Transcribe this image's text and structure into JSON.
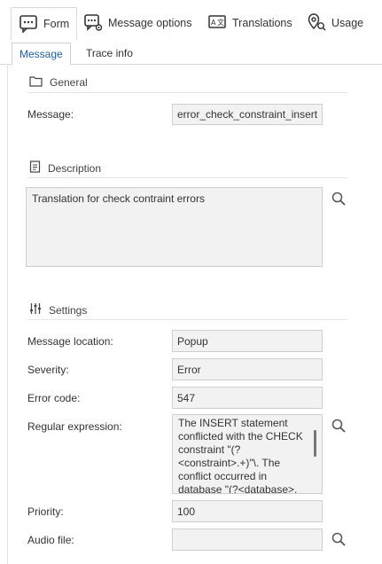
{
  "top_tabs": [
    {
      "label": "Form",
      "icon": "form-icon"
    },
    {
      "label": "Message options",
      "icon": "chat-settings-icon"
    },
    {
      "label": "Translations",
      "icon": "translate-icon"
    },
    {
      "label": "Usage",
      "icon": "usage-pin-icon"
    }
  ],
  "sub_tabs": [
    {
      "label": "Message"
    },
    {
      "label": "Trace info"
    }
  ],
  "general": {
    "heading": "General",
    "message_label": "Message:",
    "message_value": "error_check_constraint_insert"
  },
  "description": {
    "heading": "Description",
    "text": "Translation for check contraint errors"
  },
  "settings": {
    "heading": "Settings",
    "location_label": "Message location:",
    "location_value": "Popup",
    "severity_label": "Severity:",
    "severity_value": "Error",
    "error_code_label": "Error code:",
    "error_code_value": "547",
    "regex_label": "Regular expression:",
    "regex_value": "The INSERT statement conflicted with the CHECK constraint \"(?<constraint>.+)\"\\. The conflict occurred in database \"(?<database>.",
    "priority_label": "Priority:",
    "priority_value": "100",
    "audio_label": "Audio file:",
    "audio_value": ""
  },
  "colors": {
    "accent": "#1f5fa8",
    "field_bg": "#f2f2f2",
    "border": "#cfcfcf"
  }
}
